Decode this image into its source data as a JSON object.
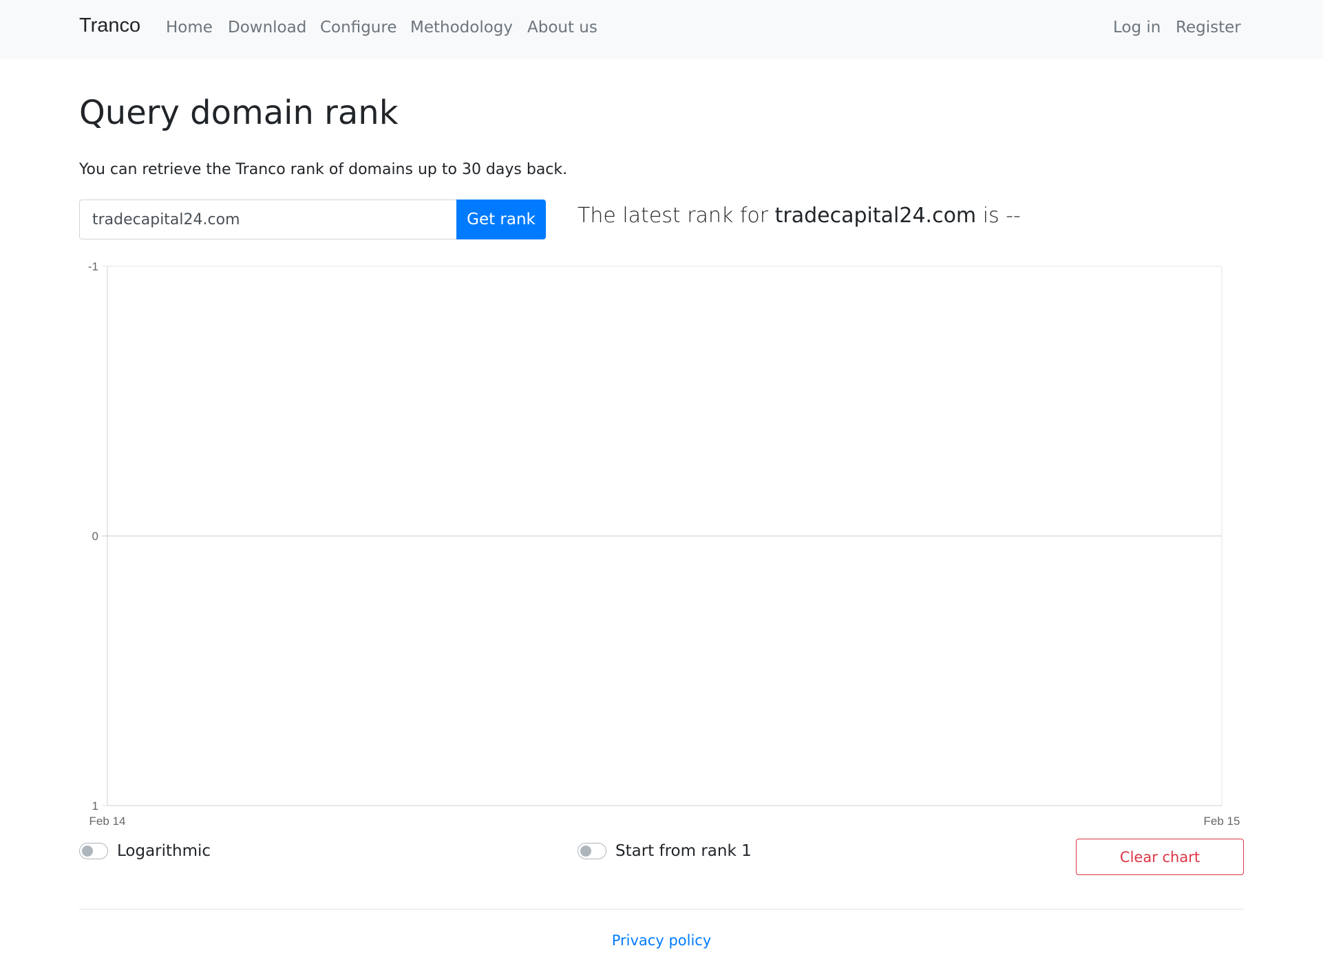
{
  "navbar": {
    "brand": "Tranco",
    "links": [
      "Home",
      "Download",
      "Configure",
      "Methodology",
      "About us"
    ],
    "auth_links": [
      "Log in",
      "Register"
    ]
  },
  "main": {
    "title": "Query domain rank",
    "lead": "You can retrieve the Tranco rank of domains up to 30 days back.",
    "search": {
      "value": "tradecapital24.com",
      "button_label": "Get rank"
    },
    "latest_rank": {
      "prefix": "The latest rank for",
      "domain": "tradecapital24.com",
      "middle": "is",
      "value": "--"
    }
  },
  "chart_data": {
    "type": "line",
    "x": [
      "Feb 14",
      "Feb 15"
    ],
    "series": [],
    "y_ticks": [
      -1,
      0,
      1
    ],
    "ylim": [
      -1,
      1
    ],
    "y_reversed": true,
    "grid": true
  },
  "controls": {
    "logarithmic_label": "Logarithmic",
    "logarithmic_on": false,
    "start_rank_label": "Start from rank 1",
    "start_rank_on": false,
    "clear_label": "Clear chart"
  },
  "footer": {
    "privacy": "Privacy policy"
  },
  "colors": {
    "primary": "#007bff",
    "danger": "#dc3545",
    "navbar_bg": "#f8f9fa",
    "muted": "#6c757d"
  }
}
